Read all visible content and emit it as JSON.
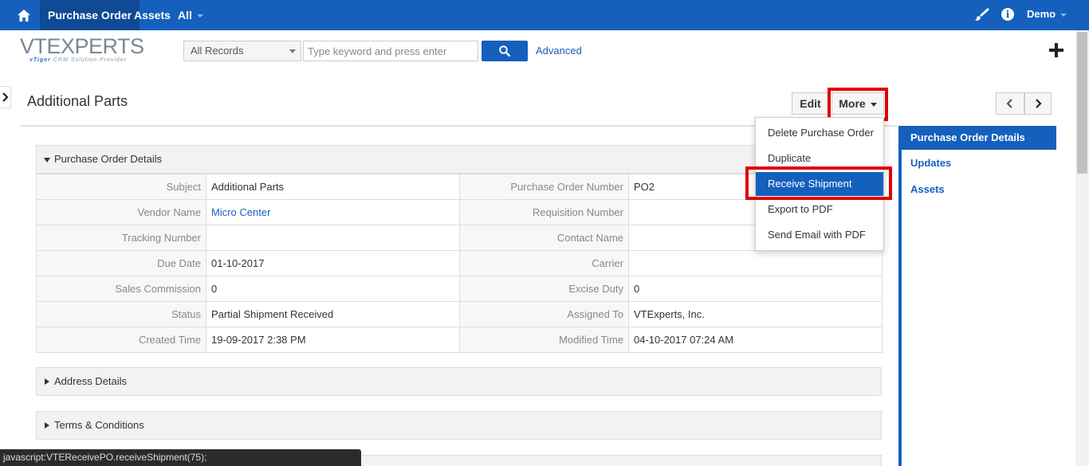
{
  "topnav": {
    "tabs": [
      {
        "label": "Purchase Order"
      },
      {
        "label": "Assets"
      },
      {
        "label": "All"
      }
    ],
    "user": "Demo",
    "icons": [
      "home-icon",
      "brush-icon",
      "info-icon"
    ]
  },
  "logo": {
    "main": "VTEXPERTS",
    "sub_brand": "vTiger",
    "sub_rest": "CRM Solution Provider"
  },
  "search": {
    "filter_value": "All Records",
    "placeholder": "Type keyword and press enter",
    "advanced_label": "Advanced"
  },
  "record": {
    "title": "Additional Parts",
    "edit_label": "Edit",
    "more_label": "More"
  },
  "more_menu": {
    "items": [
      {
        "label": "Delete Purchase Order"
      },
      {
        "label": "Duplicate"
      },
      {
        "label": "Receive Shipment"
      },
      {
        "label": "Export to PDF"
      },
      {
        "label": "Send Email with PDF"
      }
    ],
    "highlighted": "Receive Shipment"
  },
  "right_panel": {
    "links": [
      {
        "label": "Purchase Order Details"
      },
      {
        "label": "Updates"
      },
      {
        "label": "Assets"
      }
    ]
  },
  "blocks": {
    "details_title": "Purchase Order Details",
    "address_title": "Address Details",
    "terms_title": "Terms & Conditions"
  },
  "fields": [
    {
      "label1": "Subject",
      "value1": "Additional Parts",
      "label2": "Purchase Order Number",
      "value2": "PO2"
    },
    {
      "label1": "Vendor Name",
      "value1": "Micro Center",
      "label2": "Requisition Number",
      "value2": ""
    },
    {
      "label1": "Tracking Number",
      "value1": "",
      "label2": "Contact Name",
      "value2": ""
    },
    {
      "label1": "Due Date",
      "value1": "01-10-2017",
      "label2": "Carrier",
      "value2": ""
    },
    {
      "label1": "Sales Commission",
      "value1": "0",
      "label2": "Excise Duty",
      "value2": "0"
    },
    {
      "label1": "Status",
      "value1": "Partial Shipment Received",
      "label2": "Assigned To",
      "value2": "VTExperts, Inc."
    },
    {
      "label1": "Created Time",
      "value1": "19-09-2017 2:38 PM",
      "label2": "Modified Time",
      "value2": "04-10-2017 07:24 AM"
    }
  ],
  "statusbar": {
    "text": "javascript:VTEReceivePO.receiveShipment(75);"
  },
  "colors": {
    "brand_blue": "#1560bd",
    "highlight_red": "#e00000"
  }
}
